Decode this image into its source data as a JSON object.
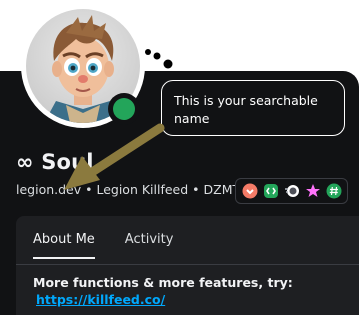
{
  "tooltip": {
    "line1": "This is your searchable",
    "line2": "name"
  },
  "profile": {
    "display_name": "∞ Soul",
    "username": "legion.dev",
    "separator": " • ",
    "pronouns_or_server": "Legion Killfeed • DZMT",
    "status": "online",
    "status_color": "#23a55a"
  },
  "badges": [
    {
      "icon": "heart-badge-icon",
      "color": "#f47b67"
    },
    {
      "icon": "developer-badge-icon",
      "color": "#23a55a"
    },
    {
      "icon": "nitro-badge-icon",
      "color": "#b5bac1"
    },
    {
      "icon": "star-badge-icon",
      "color": "#ff73fa"
    },
    {
      "icon": "hashtag-badge-icon",
      "color": "#23a55a"
    }
  ],
  "tabs": [
    {
      "label": "About Me",
      "active": true
    },
    {
      "label": "Activity",
      "active": false
    }
  ],
  "about": {
    "text": "More functions & more features, try:",
    "link": "https://killfeed.co/"
  },
  "colors": {
    "card_bg": "#111214",
    "panel_bg": "#1e1f22",
    "link": "#00a8fc",
    "arrow": "#8b7a3e"
  }
}
